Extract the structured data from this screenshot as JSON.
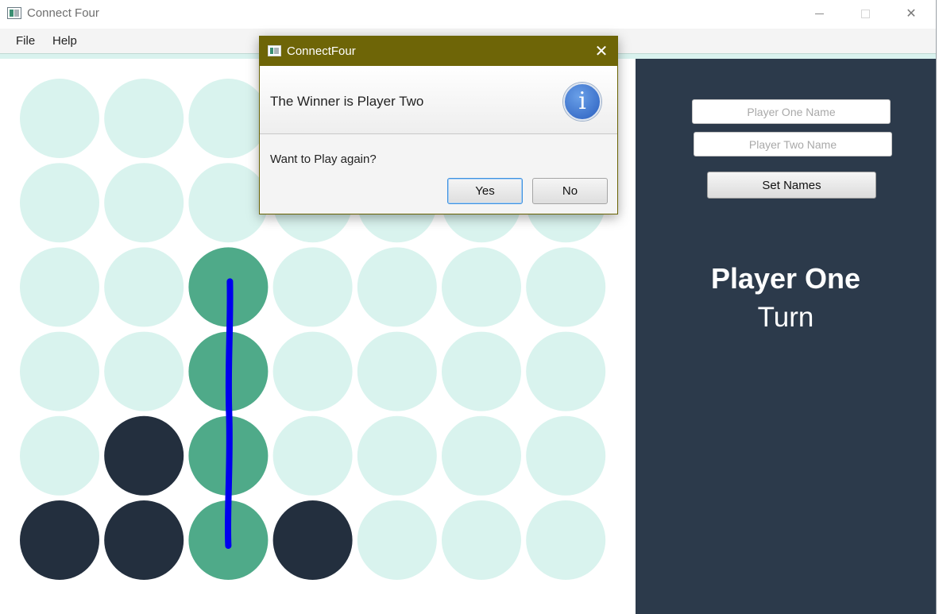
{
  "window": {
    "title": "Connect Four",
    "min_icon": "minimize-icon",
    "max_icon": "maximize-icon",
    "close_glyph": "✕"
  },
  "menu": {
    "items": [
      "File",
      "Help"
    ]
  },
  "board": {
    "columns": 7,
    "rows": 6,
    "empty_color": "#d9f3ee",
    "player_one_color": "#4faa89",
    "player_two_color": "#232f3e",
    "win_line_color": "#0000ee",
    "cells": [
      [
        "empty",
        "empty",
        "empty",
        "empty",
        "empty",
        "empty",
        "empty"
      ],
      [
        "empty",
        "empty",
        "empty",
        "empty",
        "empty",
        "empty",
        "empty"
      ],
      [
        "empty",
        "empty",
        "p1",
        "empty",
        "empty",
        "empty",
        "empty"
      ],
      [
        "empty",
        "empty",
        "p1",
        "empty",
        "empty",
        "empty",
        "empty"
      ],
      [
        "empty",
        "p2",
        "p1",
        "empty",
        "empty",
        "empty",
        "empty"
      ],
      [
        "p2",
        "p2",
        "p1",
        "p2",
        "empty",
        "empty",
        "empty"
      ]
    ]
  },
  "side": {
    "player_one_placeholder": "Player One Name",
    "player_two_placeholder": "Player Two Name",
    "set_names_label": "Set Names",
    "turn_player": "Player One",
    "turn_label": "Turn",
    "background": "#2c3a4b"
  },
  "dialog": {
    "title": "ConnectFour",
    "close_glyph": "✕",
    "header": "The Winner is Player Two",
    "info_glyph": "i",
    "content": "Want to Play again?",
    "yes_label": "Yes",
    "no_label": "No",
    "titlebar_color": "#6e6507"
  }
}
